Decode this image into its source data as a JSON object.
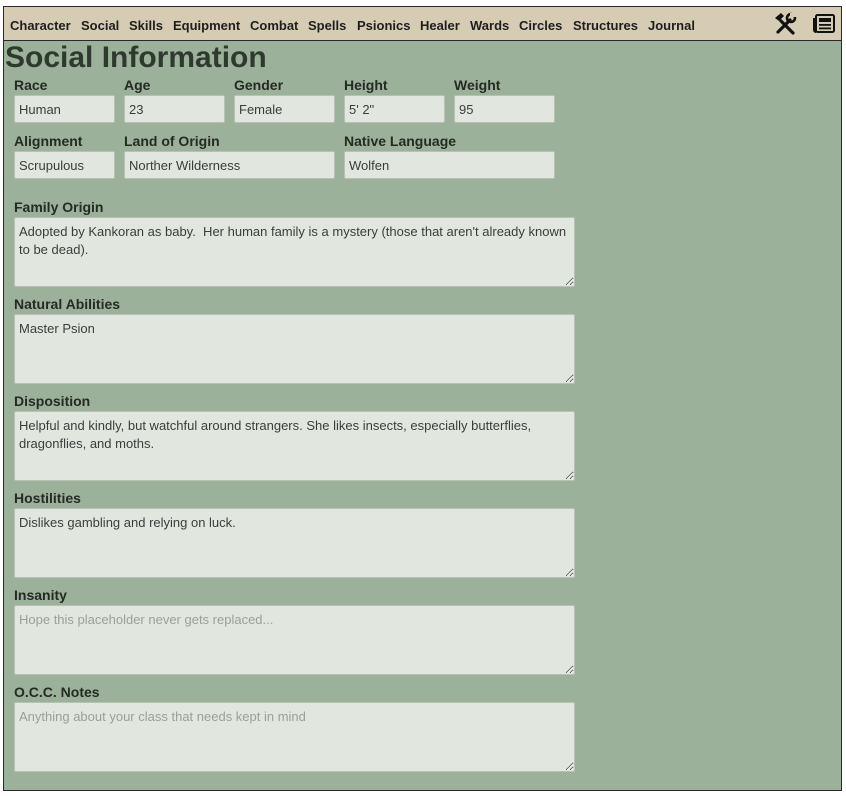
{
  "nav": {
    "items": [
      "Character",
      "Social",
      "Skills",
      "Equipment",
      "Combat",
      "Spells",
      "Psionics",
      "Healer",
      "Wards",
      "Circles",
      "Structures",
      "Journal"
    ]
  },
  "tools": {
    "settings_icon": "hammer-wrench-icon",
    "news_icon": "newspaper-icon"
  },
  "page": {
    "title": "Social Information"
  },
  "fields": {
    "race": {
      "label": "Race",
      "value": "Human"
    },
    "age": {
      "label": "Age",
      "value": "23"
    },
    "gender": {
      "label": "Gender",
      "value": "Female"
    },
    "height": {
      "label": "Height",
      "value": "5' 2\""
    },
    "weight": {
      "label": "Weight",
      "value": "95"
    },
    "alignment": {
      "label": "Alignment",
      "value": "Scrupulous"
    },
    "land": {
      "label": "Land of Origin",
      "value": "Norther Wilderness"
    },
    "language": {
      "label": "Native Language",
      "value": "Wolfen"
    }
  },
  "textareas": {
    "family": {
      "label": "Family Origin",
      "value": "Adopted by Kankoran as baby.  Her human family is a mystery (those that aren't already known to be dead).",
      "placeholder": ""
    },
    "natural": {
      "label": "Natural Abilities",
      "value": "Master Psion",
      "placeholder": ""
    },
    "disposition": {
      "label": "Disposition",
      "value": "Helpful and kindly, but watchful around strangers. She likes insects, especially butterflies, dragonflies, and moths.",
      "placeholder": ""
    },
    "hostilities": {
      "label": "Hostilities",
      "value": "Dislikes gambling and relying on luck.",
      "placeholder": ""
    },
    "insanity": {
      "label": "Insanity",
      "value": "",
      "placeholder": "Hope this placeholder never gets replaced..."
    },
    "occ": {
      "label": "O.C.C. Notes",
      "value": "",
      "placeholder": "Anything about your class that needs kept in mind"
    }
  },
  "colors": {
    "background": "#9cb19a",
    "navbar": "#d6ccb4",
    "field": "#e1e7df",
    "title": "#2f3a2f"
  }
}
